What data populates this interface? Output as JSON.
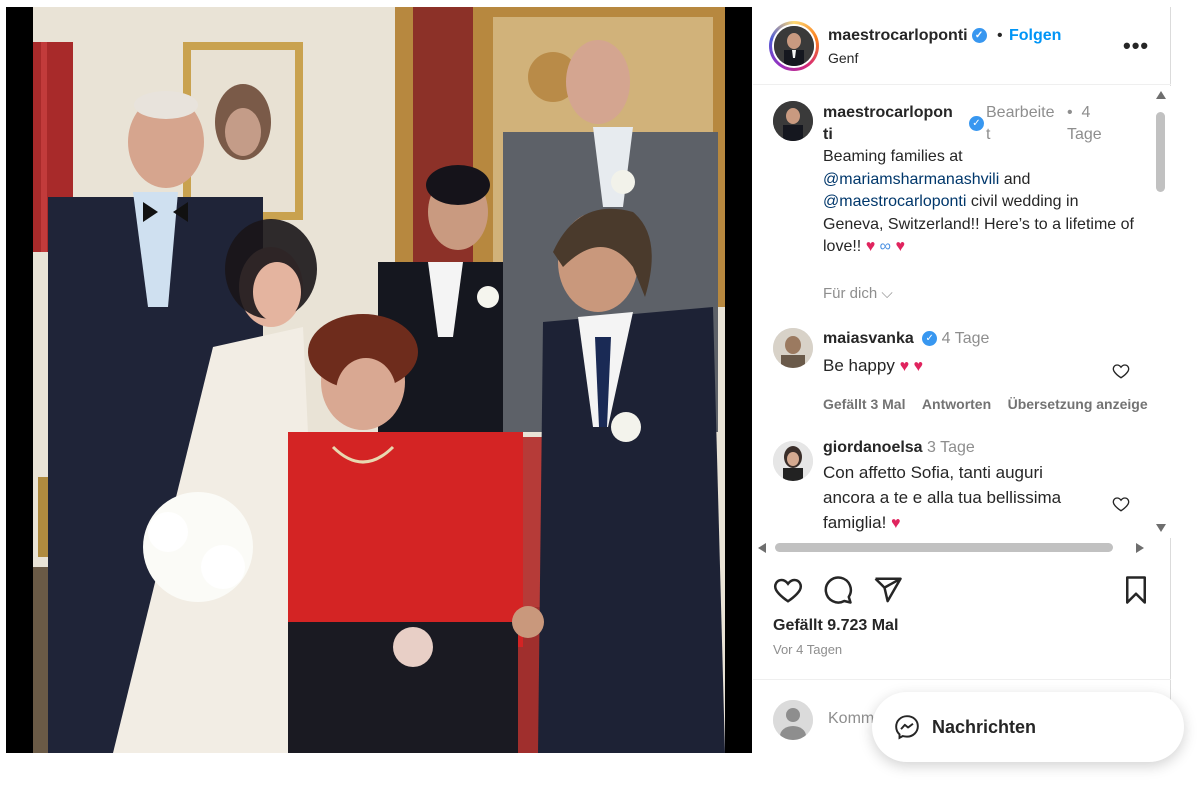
{
  "post": {
    "username": "maestrocarloponti",
    "follow_label": "Folgen",
    "separator": "•",
    "location": "Genf",
    "more_label": "•••"
  },
  "caption": {
    "username_line1": "maestrocarlopon",
    "username_line2": "ti",
    "edited_line1": "Bearbeite",
    "edited_line2": "t",
    "time_sep": "•",
    "time_line1": "4",
    "time_line2": "Tage",
    "text_1": "Beaming families at ",
    "mention_1": "@mariamsharmanashvili",
    "text_2": " and ",
    "mention_2": "@maestrocarloponti",
    "text_3": " civil wedding in Geneva, Switzerland!! Here’s to a lifetime of love!! ",
    "emoji_heart": "♥",
    "emoji_infinity": "∞",
    "see_more": "Für dich ⌵"
  },
  "comments": [
    {
      "username": "maiasvanka",
      "time": "4 Tage",
      "text": "Be happy ",
      "emoji": "♥ ♥",
      "likes": "Gefällt 3 Mal",
      "reply": "Antworten",
      "translate": "Übersetzung anzeige"
    },
    {
      "username": "giordanoelsa",
      "time": "3 Tage",
      "text_line1": "Con affetto Sofia, tanti auguri",
      "text_line2": "ancora a te e alla tua bellissima",
      "text_line3": "famiglia! ",
      "emoji": "♥"
    }
  ],
  "stats": {
    "likes": "Gefällt 9.723 Mal",
    "date": "Vor 4 Tagen"
  },
  "add_comment": {
    "placeholder": "Kommentieren ..."
  },
  "messages": {
    "label": "Nachrichten"
  },
  "icons": {
    "like": "heart-icon",
    "comment": "comment-icon",
    "share": "share-icon",
    "save": "bookmark-icon",
    "messenger": "messenger-icon"
  },
  "colors": {
    "link_blue": "#0095f6",
    "mention": "#00376b",
    "verified": "#3897f0",
    "heart": "#e0245e"
  }
}
